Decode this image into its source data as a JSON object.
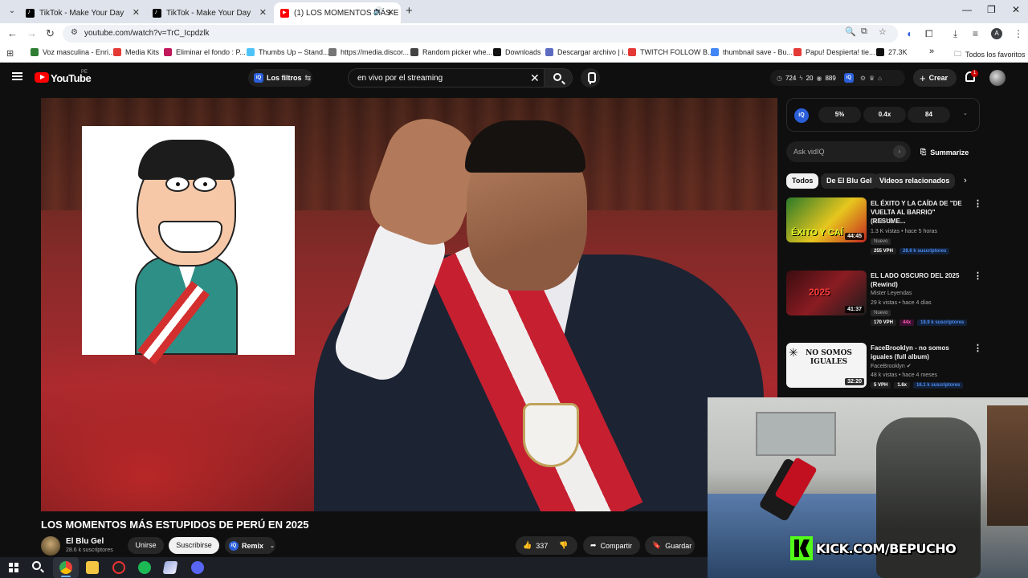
{
  "browser": {
    "tabs": [
      {
        "title": "TikTok - Make Your Day",
        "active": false
      },
      {
        "title": "TikTok - Make Your Day",
        "active": false
      },
      {
        "title": "(1) LOS MOMENTOS MÁS E",
        "active": true
      }
    ],
    "url": "youtube.com/watch?v=TrC_Icpdzlk",
    "profile_initial": "A",
    "bookmarks": [
      {
        "label": "Voz masculina - Enri...",
        "color": "#2e7d32"
      },
      {
        "label": "Media Kits",
        "color": "#e53935"
      },
      {
        "label": "Eliminar el fondo : P...",
        "color": "#c2185b"
      },
      {
        "label": "Thumbs Up – Stand...",
        "color": "#4fc3f7"
      },
      {
        "label": "https://media.discor...",
        "color": "#757575"
      },
      {
        "label": "Random picker whe...",
        "color": "#424242"
      },
      {
        "label": "Downloads",
        "color": "#111111"
      },
      {
        "label": "Descargar archivo | i...",
        "color": "#5c6bc0"
      },
      {
        "label": "TWITCH FOLLOW B...",
        "color": "#e53935"
      },
      {
        "label": "thumbnail save - Bu...",
        "color": "#4285f4"
      },
      {
        "label": "Papu! Despierta! tie...",
        "color": "#e53935"
      },
      {
        "label": "27.3K",
        "color": "#111111"
      }
    ],
    "bookmarks_more": "»",
    "all_bookmarks": "Todos los favoritos"
  },
  "youtube": {
    "logo_text": "YouTube",
    "country": "PE",
    "filters_label": "Los filtros",
    "filters_badge": "iQ",
    "search_value": "en vivo por el streaming",
    "stats": {
      "a": "724",
      "b": "20",
      "c": "889"
    },
    "create_label": "Crear",
    "notif_count": "1"
  },
  "video": {
    "title": "LOS MOMENTOS MÁS ESTUPIDOS DE PERÚ EN 2025",
    "channel": "El Blu Gel",
    "subscribers": "28.6 k suscriptores",
    "join_label": "Unirse",
    "subscribe_label": "Suscribirse",
    "remix_label": "Remix",
    "likes": "337",
    "share_label": "Compartir",
    "save_label": "Guardar"
  },
  "vidiq": {
    "logo": "iQ",
    "stats": [
      "5%",
      "0.4x",
      "84"
    ],
    "ask_placeholder": "Ask vidIQ",
    "summarize_label": "Summarize"
  },
  "chips": [
    "Todos",
    "De El Blu Gel",
    "Videos relacionados"
  ],
  "related": [
    {
      "title": "EL ÉXITO Y LA CAÍDA DE \"DE VUELTA AL BARRIO\" (RESUME...",
      "channel": "El Blu Gel",
      "meta": "1.3 K vistas • hace 5 horas",
      "nuevo": "Nuevo",
      "duration": "44:45",
      "badges": [
        {
          "text": "255 VPH",
          "style": "plain"
        },
        {
          "text": "28.6 k suscriptores",
          "style": "blue"
        }
      ],
      "thumb_text": "ÉXITO Y CAÍ"
    },
    {
      "title": "EL LADO OSCURO DEL 2025 (Rewind)",
      "channel": "Mister Leyendas",
      "meta": "29 k vistas • hace 4 días",
      "nuevo": "Nuevo",
      "duration": "41:37",
      "badges": [
        {
          "text": "170 VPH",
          "style": "plain"
        },
        {
          "text": "44x",
          "style": "pink"
        },
        {
          "text": "18.9 k suscriptores",
          "style": "blue"
        }
      ],
      "thumb_text": "2025"
    },
    {
      "title": "FaceBrooklyn - no somos iguales (full album)",
      "channel": "FaceBrooklyn",
      "meta": "48 k vistas • hace 4 meses",
      "nuevo": "",
      "duration": "32:20",
      "badges": [
        {
          "text": "5 VPH",
          "style": "plain"
        },
        {
          "text": "1.6x",
          "style": "plain"
        },
        {
          "text": "16.1 k suscriptores",
          "style": "blue"
        }
      ],
      "thumb_text": "NO SOMOS IGUALES"
    }
  ],
  "webcam": {
    "banner": "KICK.COM/BEPUCHO"
  }
}
